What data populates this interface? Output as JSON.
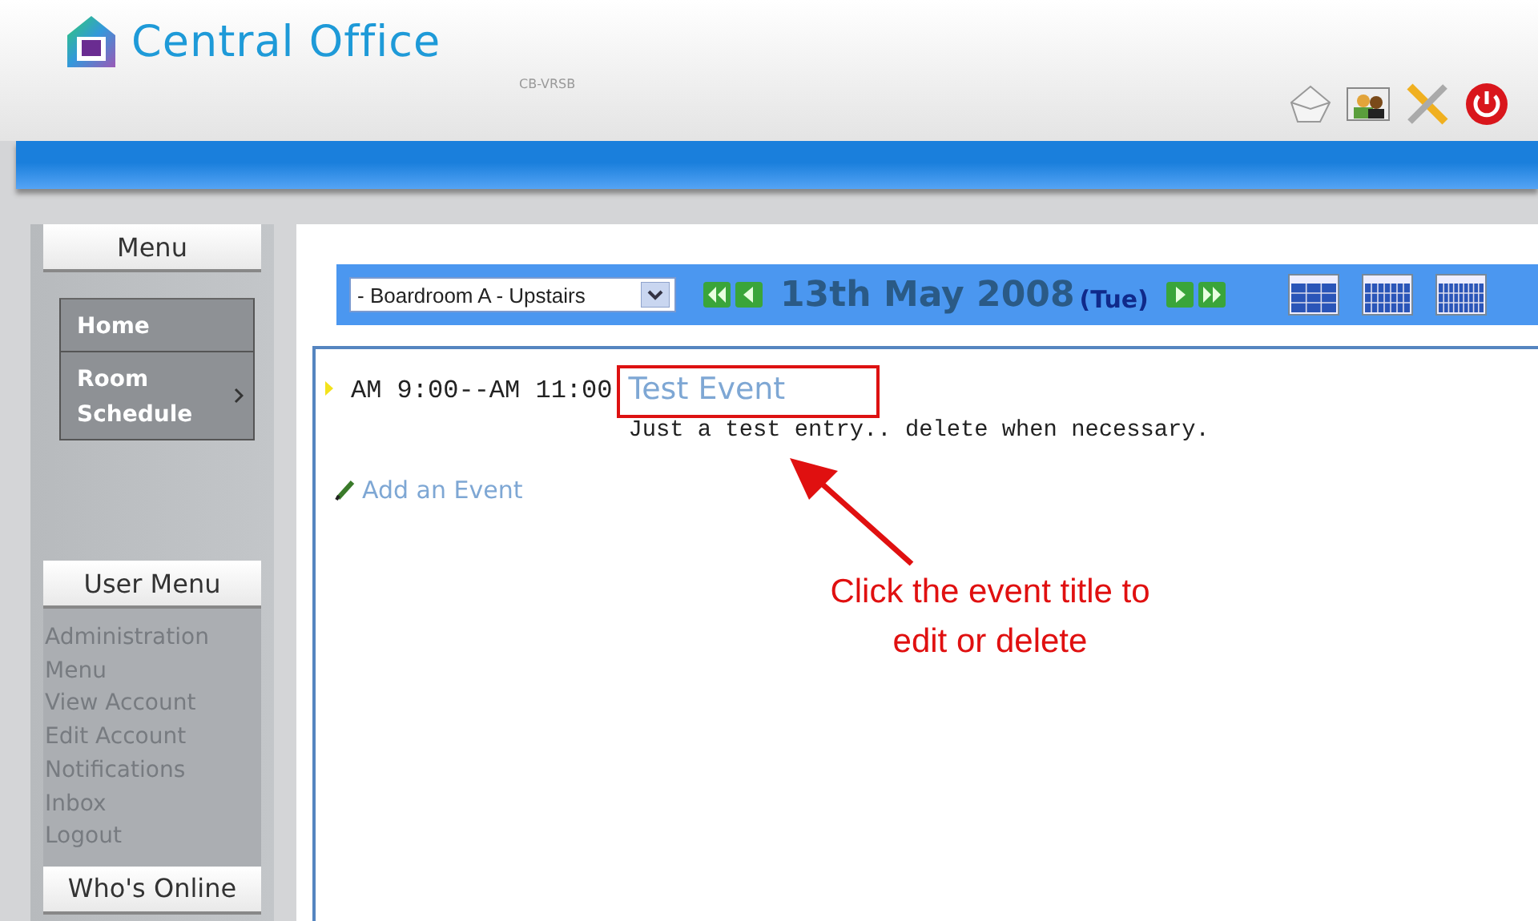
{
  "header": {
    "title": "Central Office",
    "subtitle": "CB-VRSB"
  },
  "sidebar": {
    "menu_title": "Menu",
    "menu_items": [
      {
        "label": "Home",
        "has_submenu": false
      },
      {
        "label": "Room Schedule",
        "has_submenu": true
      }
    ],
    "user_menu_title": "User Menu",
    "user_menu_items": [
      "Administration Menu",
      "View Account",
      "Edit Account",
      "Notifications",
      "Inbox",
      "Logout"
    ],
    "online_title": "Who's Online"
  },
  "toolbar": {
    "room": "- Boardroom A - Upstairs",
    "date": "13th May 2008",
    "weekday": "(Tue)"
  },
  "events": [
    {
      "time": "AM 9:00--AM 11:00",
      "title": "Test Event",
      "description": "Just a test entry.. delete when necessary."
    }
  ],
  "add_event": "Add an Event",
  "annotation": {
    "text": "Click the event title to edit or delete"
  }
}
